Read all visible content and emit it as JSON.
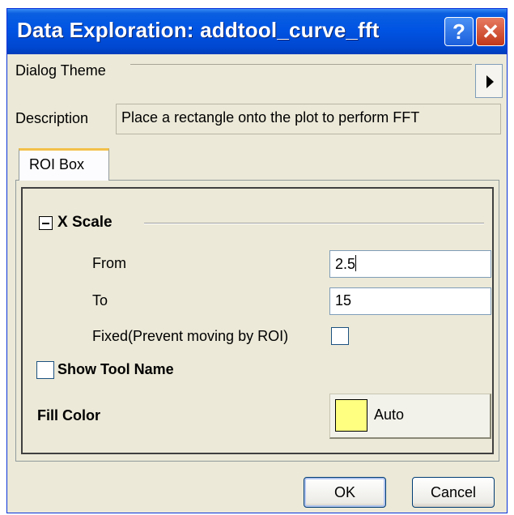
{
  "window": {
    "title": "Data Exploration: addtool_curve_fft",
    "help_glyph": "?",
    "close_glyph": "✕"
  },
  "dialog_theme": {
    "label": "Dialog Theme",
    "value": ""
  },
  "description": {
    "label": "Description",
    "value": "Place a rectangle onto the plot to perform FFT"
  },
  "tabs": [
    {
      "label": "ROI Box",
      "selected": true
    }
  ],
  "x_scale": {
    "title": "X Scale",
    "expanded": true,
    "from_label": "From",
    "from_value": "2.5",
    "to_label": "To",
    "to_value": "15",
    "fixed_label": "Fixed(Prevent moving by ROI)",
    "fixed_checked": false
  },
  "show_tool_name": {
    "label": "Show Tool Name",
    "checked": false
  },
  "fill_color": {
    "label": "Fill Color",
    "value_label": "Auto",
    "swatch_color": "#ffff80"
  },
  "buttons": {
    "ok": "OK",
    "cancel": "Cancel"
  }
}
